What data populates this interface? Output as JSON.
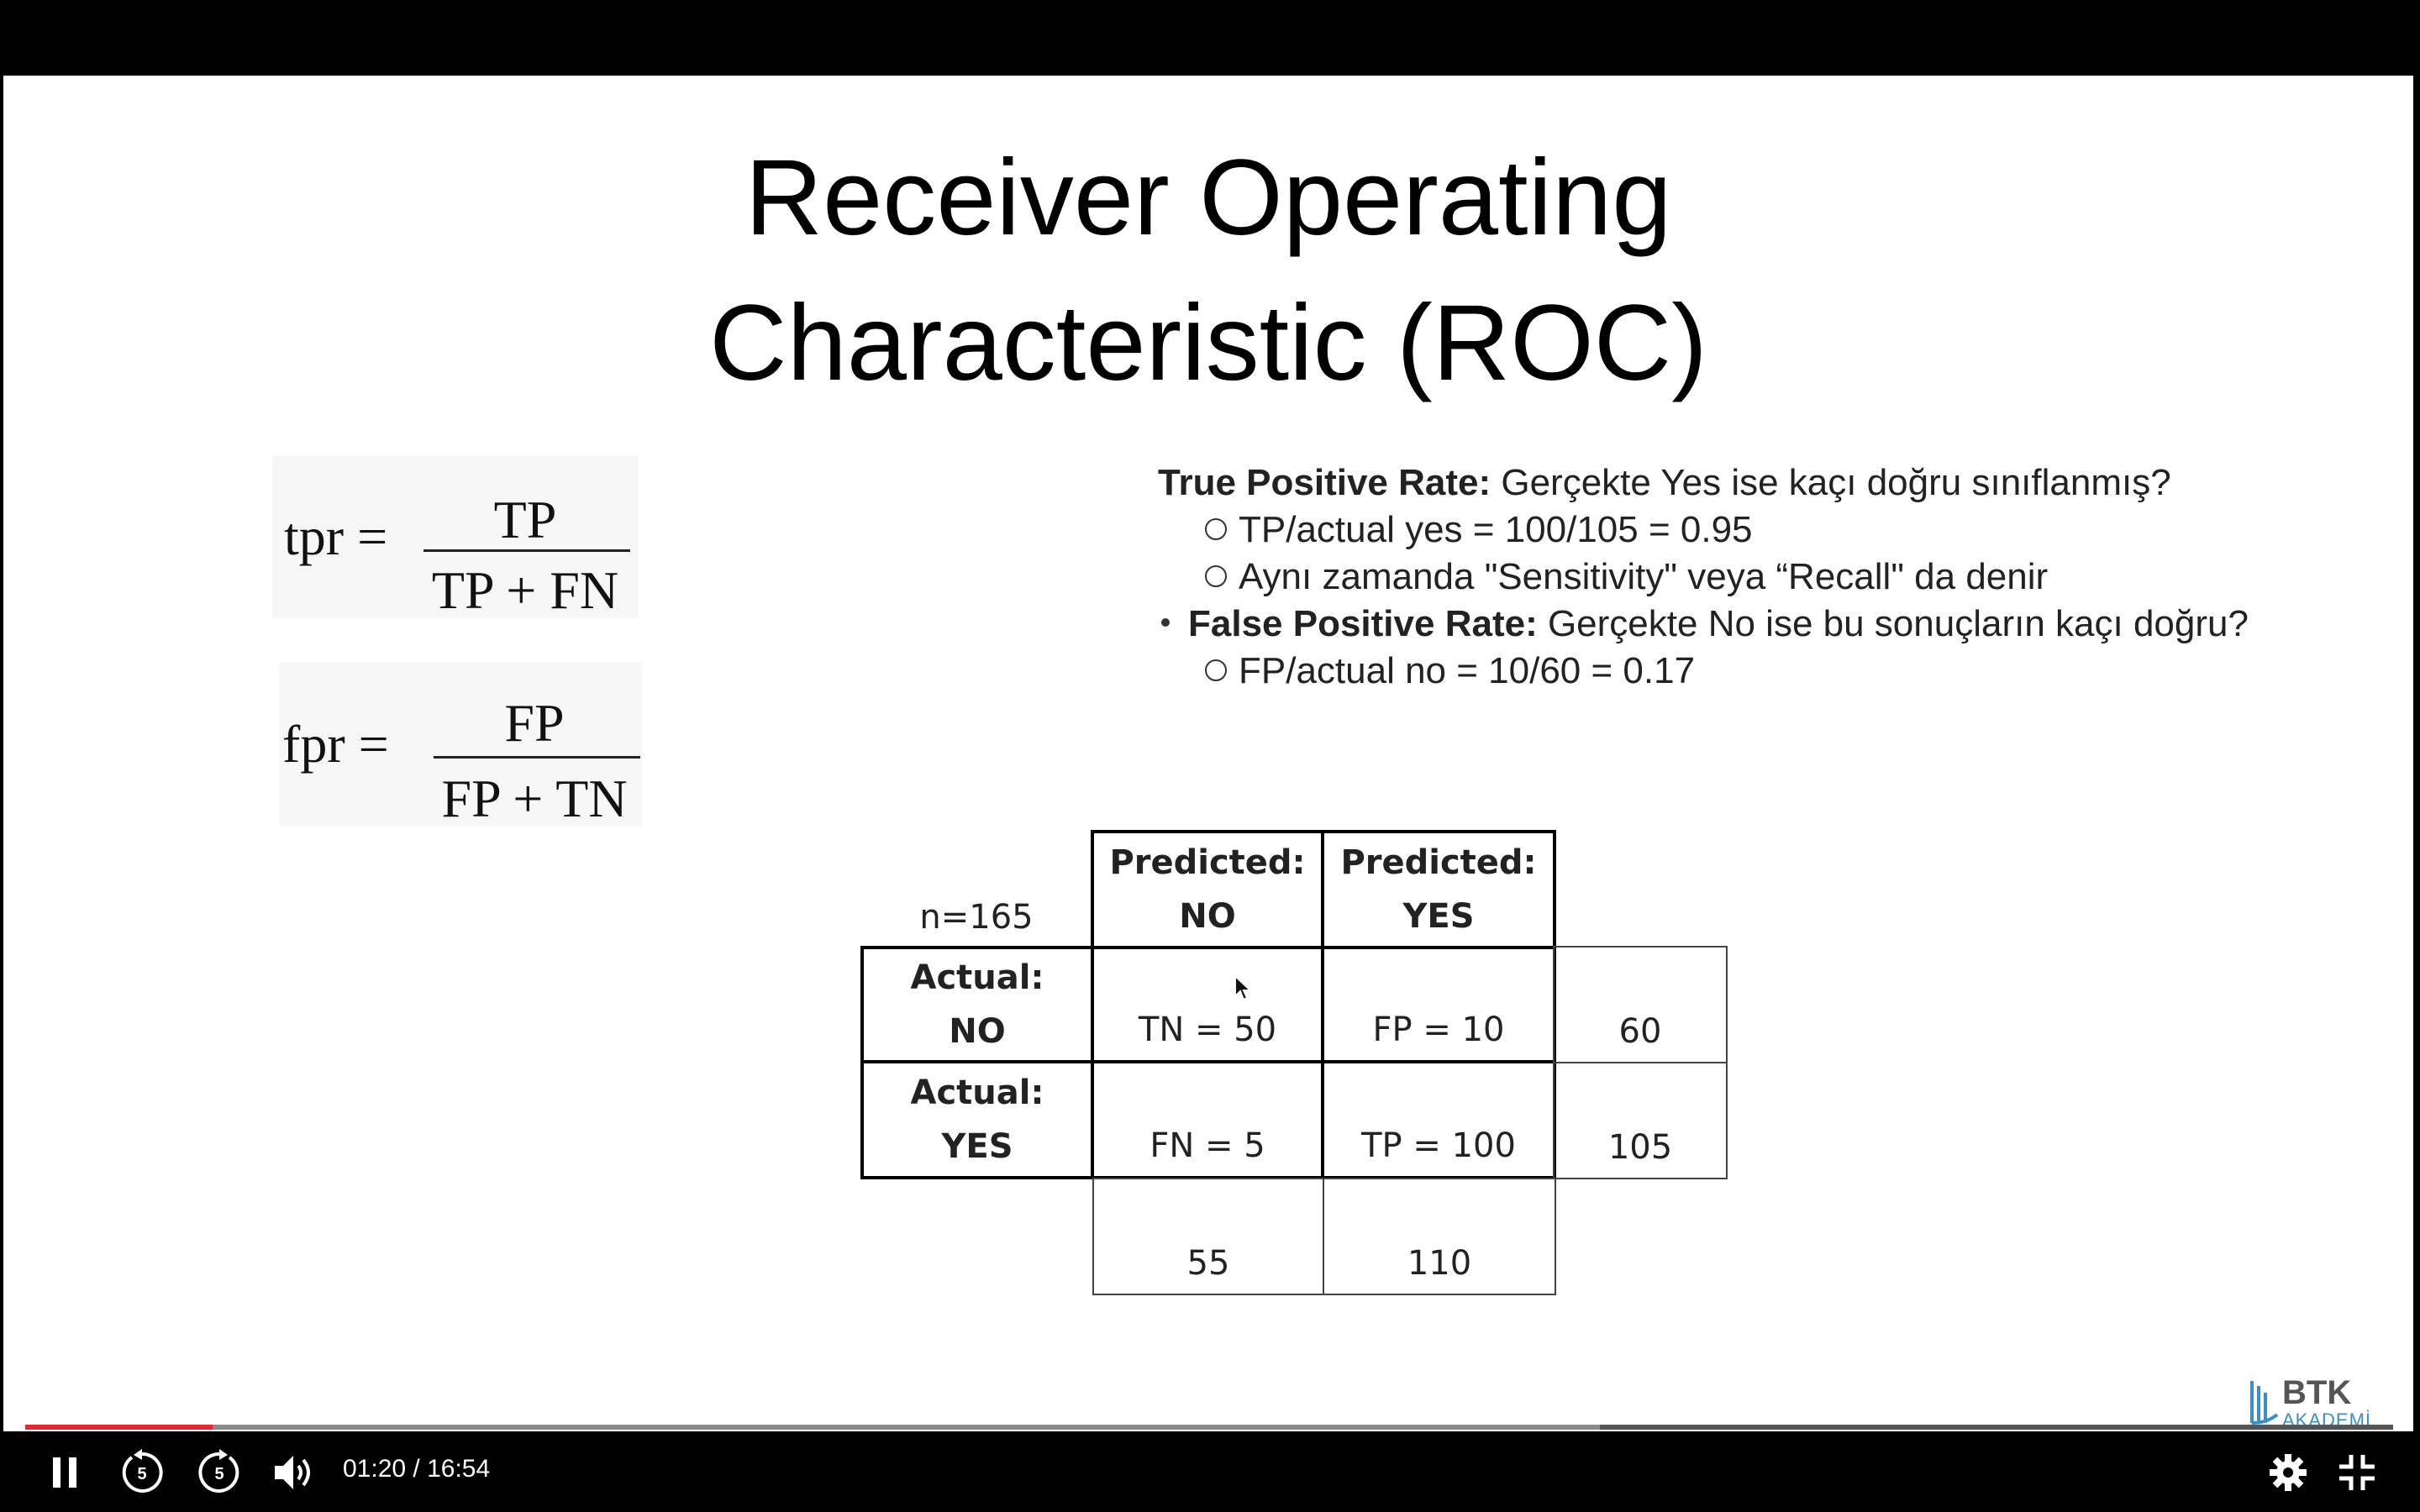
{
  "slide": {
    "title_line1": "Receiver Operating",
    "title_line2": "Characteristic (ROC)",
    "formulas": {
      "tpr": {
        "lhs": "tpr =",
        "numerator": "TP",
        "denominator": "TP + FN"
      },
      "fpr": {
        "lhs": "fpr =",
        "numerator": "FP",
        "denominator": "FP + TN"
      }
    },
    "bullets": {
      "b1_bold": "True Positive Rate:",
      "b1_text": " Gerçekte Yes ise kaçı doğru sınıflanmış?",
      "b1_sub1": "TP/actual yes = 100/105 = 0.95",
      "b1_sub2": "Aynı zamanda  \"Sensitivity\" veya “Recall\" da denir",
      "b2_bold": "False Positive Rate:",
      "b2_text": " Gerçekte No ise bu sonuçların kaçı doğru?",
      "b2_sub1": "FP/actual no = 10/60 = 0.17"
    },
    "matrix": {
      "n_label": "n=165",
      "col_headers": [
        {
          "line1": "Predicted:",
          "line2": "NO"
        },
        {
          "line1": "Predicted:",
          "line2": "YES"
        }
      ],
      "rows": [
        {
          "line1": "Actual:",
          "line2": "NO",
          "cells": [
            "TN = 50",
            "FP = 10"
          ],
          "total": "60"
        },
        {
          "line1": "Actual:",
          "line2": "YES",
          "cells": [
            "FN = 5",
            "TP = 100"
          ],
          "total": "105"
        }
      ],
      "col_totals": [
        "55",
        "110"
      ]
    },
    "logo_text1": "BTK",
    "logo_text2": "AKADEMİ"
  },
  "player": {
    "time": "01:20 / 16:54",
    "progress_fraction": 0.079,
    "buffer_fraction": 0.665,
    "icons": [
      "pause-icon",
      "rewind-5-icon",
      "forward-5-icon",
      "volume-icon",
      "settings-icon",
      "exit-fullscreen-icon"
    ],
    "skip_seconds": "5"
  }
}
